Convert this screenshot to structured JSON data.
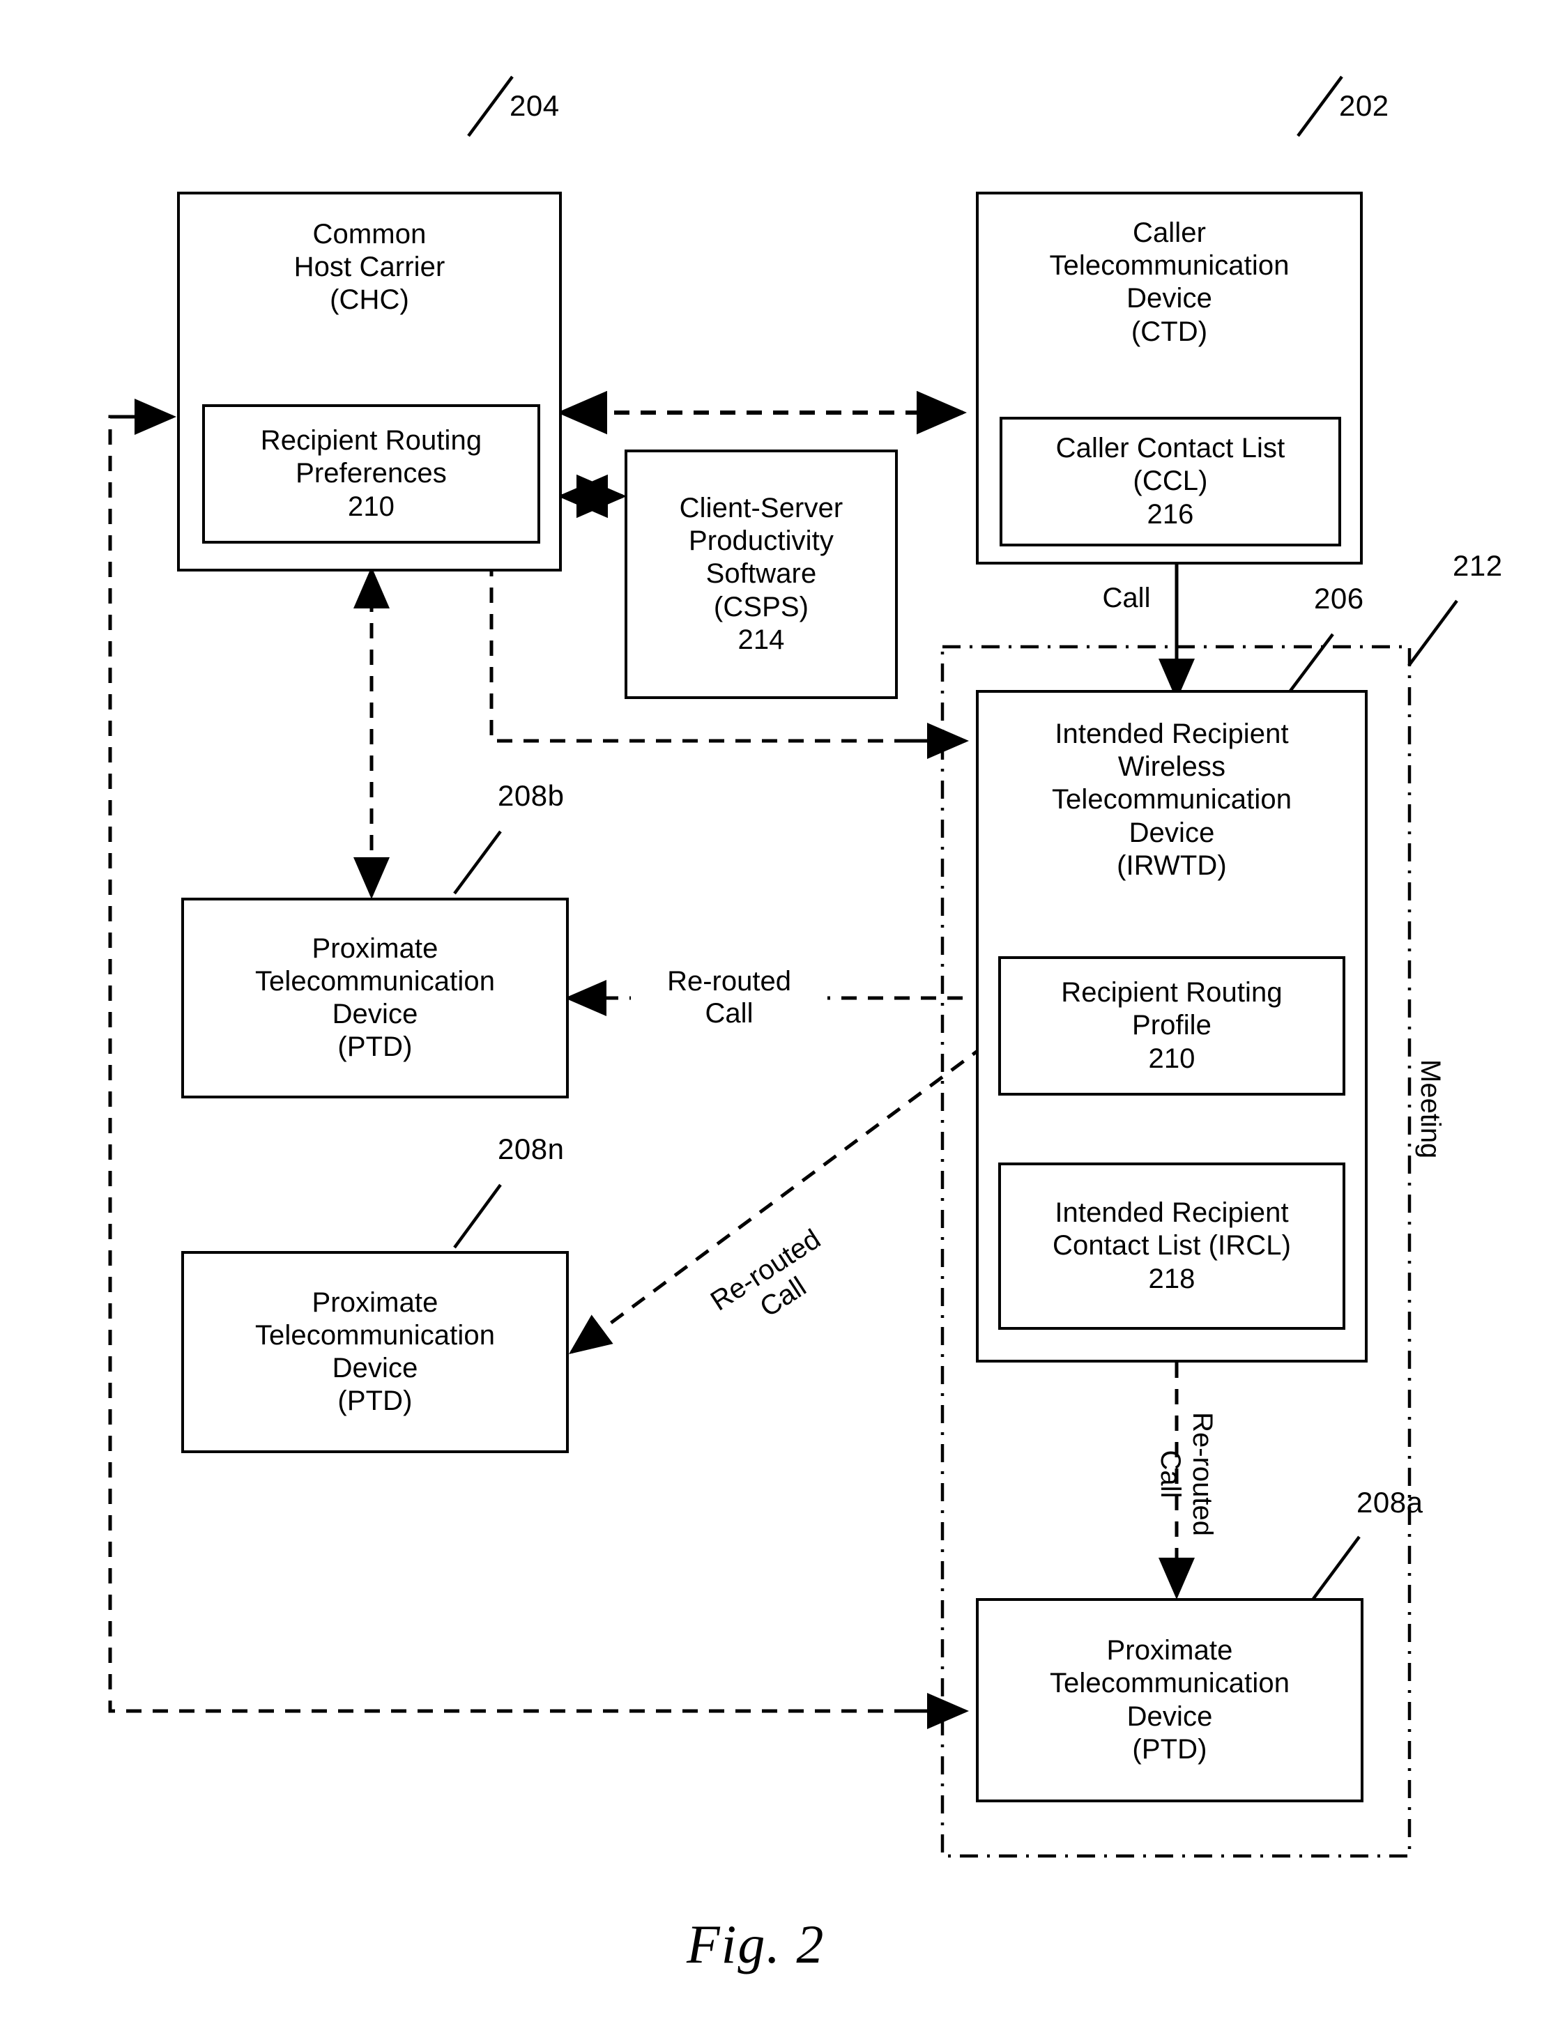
{
  "figure": {
    "caption": "Fig. 2",
    "sheet_width": 2215,
    "sheet_height": 2917,
    "line_color": "#000000",
    "background_color": "#ffffff"
  },
  "blocks": {
    "chc": {
      "ref": "204",
      "title": "Common\nHost Carrier\n(CHC)",
      "inner": {
        "ref": "210",
        "title": "Recipient Routing\nPreferences\n210"
      }
    },
    "ctd": {
      "ref": "202",
      "title": "Caller\nTelecommunication\nDevice\n(CTD)",
      "inner": {
        "ref": "216",
        "title": "Caller Contact List\n(CCL)\n216"
      }
    },
    "csps": {
      "ref": "214",
      "title": "Client-Server\nProductivity\nSoftware\n(CSPS)\n214"
    },
    "irwtd": {
      "ref": "206",
      "title": "Intended Recipient\nWireless\nTelecommunication\nDevice\n(IRWTD)",
      "inner_profile": {
        "ref": "210",
        "title": "Recipient Routing\nProfile\n210"
      },
      "inner_ircl": {
        "ref": "218",
        "title": "Intended Recipient\nContact List (IRCL)\n218"
      }
    },
    "ptd_b": {
      "ref": "208b",
      "title": "Proximate\nTelecommunication\nDevice\n(PTD)"
    },
    "ptd_n": {
      "ref": "208n",
      "title": "Proximate\nTelecommunication\nDevice\n(PTD)"
    },
    "ptd_a": {
      "ref": "208a",
      "title": "Proximate\nTelecommunication\nDevice\n(PTD)"
    },
    "meeting_region": {
      "ref": "212",
      "label": "Meeting"
    }
  },
  "edge_labels": {
    "call": "Call",
    "rerouted_call_b": "Re-routed\nCall",
    "rerouted_call_n": "Re-routed\nCall",
    "rerouted_call_a": "Re-routed\nCall"
  },
  "reference_numerals": [
    {
      "id": "204",
      "target": "chc"
    },
    {
      "id": "202",
      "target": "ctd"
    },
    {
      "id": "214",
      "target": "csps"
    },
    {
      "id": "206",
      "target": "irwtd"
    },
    {
      "id": "212",
      "target": "meeting_region"
    },
    {
      "id": "210",
      "target": "recipient-routing"
    },
    {
      "id": "216",
      "target": "ccl"
    },
    {
      "id": "218",
      "target": "ircl"
    },
    {
      "id": "208a",
      "target": "ptd_a"
    },
    {
      "id": "208b",
      "target": "ptd_b"
    },
    {
      "id": "208n",
      "target": "ptd_n"
    }
  ]
}
